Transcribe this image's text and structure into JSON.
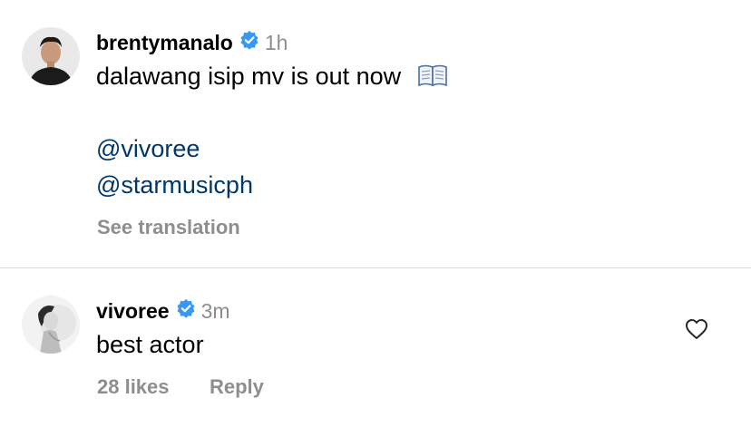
{
  "post": {
    "username": "brentymanalo",
    "time": "1h",
    "caption": "dalawang isip mv is out now",
    "caption_emoji": "open-book-emoji",
    "mentions": [
      "@vivoree",
      "@starmusicph"
    ],
    "see_translation": "See translation"
  },
  "comment": {
    "username": "vivoree",
    "time": "3m",
    "text": "best actor",
    "likes": "28 likes",
    "reply": "Reply"
  },
  "colors": {
    "link": "#00376b",
    "muted": "#8e8e8e",
    "verified": "#3897f0",
    "divider": "#dbdbdb"
  }
}
